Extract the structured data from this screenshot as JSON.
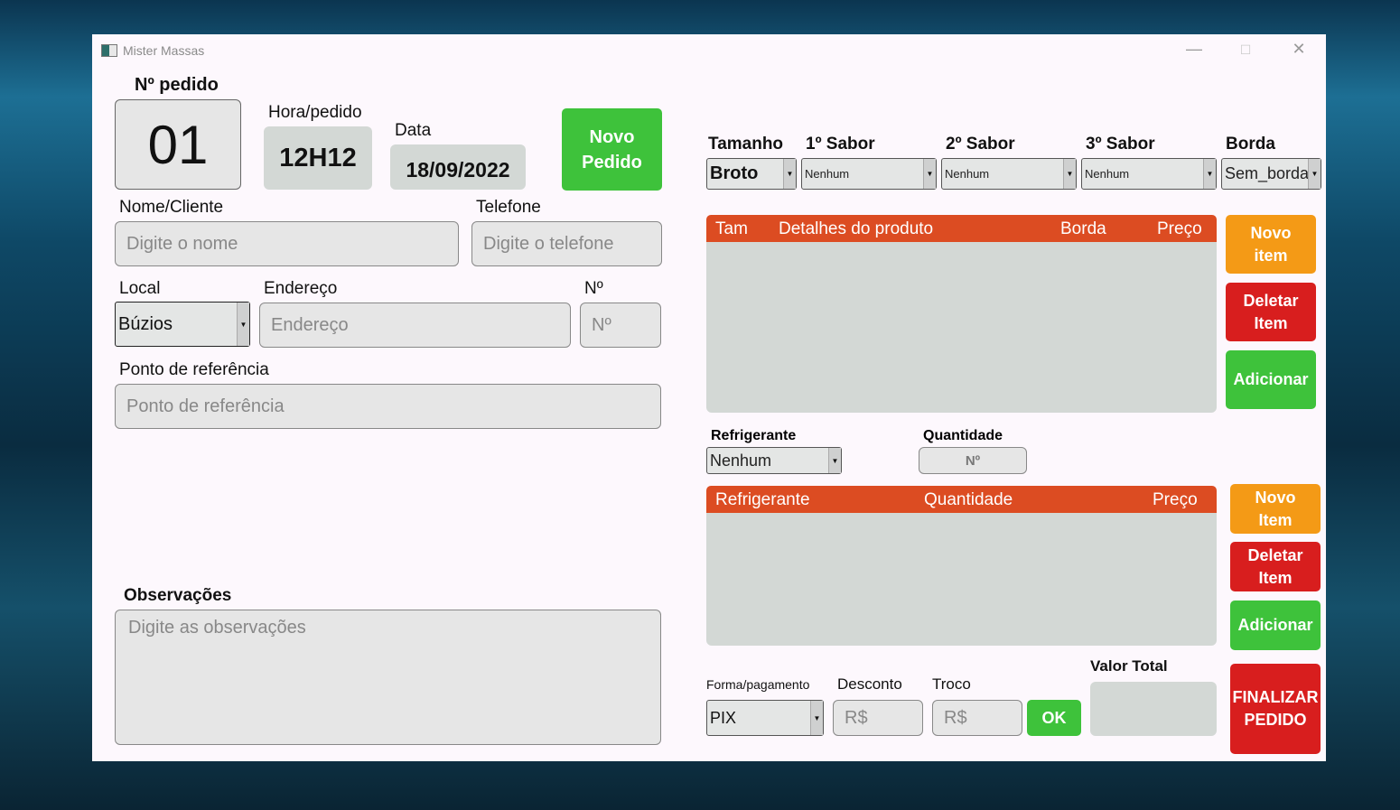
{
  "window": {
    "title": "Mister Massas",
    "minimize": "—",
    "maximize": "☐",
    "close": "✕"
  },
  "order": {
    "number_label": "Nº pedido",
    "number": "01",
    "time_label": "Hora/pedido",
    "time": "12H12",
    "date_label": "Data",
    "date": "18/09/2022",
    "new_order": "Novo Pedido"
  },
  "customer": {
    "name_label": "Nome/Cliente",
    "name_placeholder": "Digite o nome",
    "phone_label": "Telefone",
    "phone_placeholder": "Digite o telefone",
    "local_label": "Local",
    "local_value": "Búzios",
    "address_label": "Endereço",
    "address_placeholder": "Endereço",
    "num_label": "Nº",
    "num_placeholder": "Nº",
    "ref_label": "Ponto de referência",
    "ref_placeholder": "Ponto de referência",
    "obs_label": "Observações",
    "obs_placeholder": "Digite as observações"
  },
  "pizza": {
    "size_label": "Tamanho",
    "size": "Broto",
    "flavor1_label": "1º Sabor",
    "flavor1": "Nenhum",
    "flavor2_label": "2º Sabor",
    "flavor2": "Nenhum",
    "flavor3_label": "3º Sabor",
    "flavor3": "Nenhum",
    "crust_label": "Borda",
    "crust": "Sem_borda",
    "columns": [
      "Tam",
      "Detalhes do produto",
      "Borda",
      "Preço"
    ],
    "new_item": "Novo item",
    "delete_item": "Deletar Item",
    "add": "Adicionar"
  },
  "drinks": {
    "drink_label": "Refrigerante",
    "drink": "Nenhum",
    "qty_label": "Quantidade",
    "qty_placeholder": "Nº",
    "columns": [
      "Refrigerante",
      "Quantidade",
      "Preço"
    ],
    "new_item": "Novo Item",
    "delete_item": "Deletar Item",
    "add": "Adicionar"
  },
  "payment": {
    "method_label": "Forma/pagamento",
    "method": "PIX",
    "discount_label": "Desconto",
    "discount_placeholder": "R$",
    "change_label": "Troco",
    "change_placeholder": "R$",
    "ok": "OK",
    "total_label": "Valor Total",
    "total": "",
    "finish": "FINALIZAR PEDIDO"
  }
}
